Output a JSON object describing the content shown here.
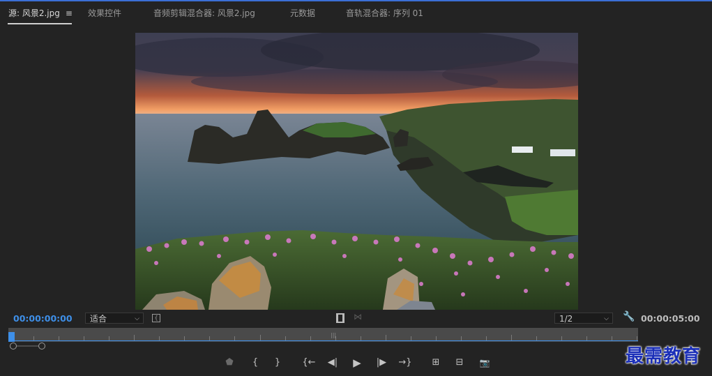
{
  "tabs": [
    {
      "label": "源: 风景2.jpg",
      "active": true
    },
    {
      "label": "效果控件",
      "active": false
    },
    {
      "label": "音频剪辑混合器: 风景2.jpg",
      "active": false
    },
    {
      "label": "元数据",
      "active": false
    },
    {
      "label": "音轨混合器: 序列 01",
      "active": false
    }
  ],
  "menu_icon": "≡",
  "controls": {
    "timecode_current": "00:00:00:00",
    "zoom_select": "适合",
    "resolution_select": "1/2",
    "timecode_duration": "00:00:05:00"
  },
  "transport": {
    "marker": "⬟",
    "mark_in": "{",
    "mark_out": "}",
    "goto_in": "{←",
    "step_back": "◀|",
    "play": "▶",
    "step_forward": "|▶",
    "goto_out": "→}",
    "insert": "⊞",
    "overwrite": "⊟",
    "export_frame": "📷"
  },
  "watermark": "最需教育",
  "add_button": "+",
  "icons": [
    "menu-icon",
    "chevron-down-icon",
    "safe-margin-icon",
    "film-icon",
    "waveform-icon",
    "wrench-icon",
    "marker-icon",
    "camera-icon",
    "plus-icon"
  ],
  "colors": {
    "accent": "#3e8fe8",
    "background": "#232323",
    "watermark": "#1b2fb8"
  }
}
